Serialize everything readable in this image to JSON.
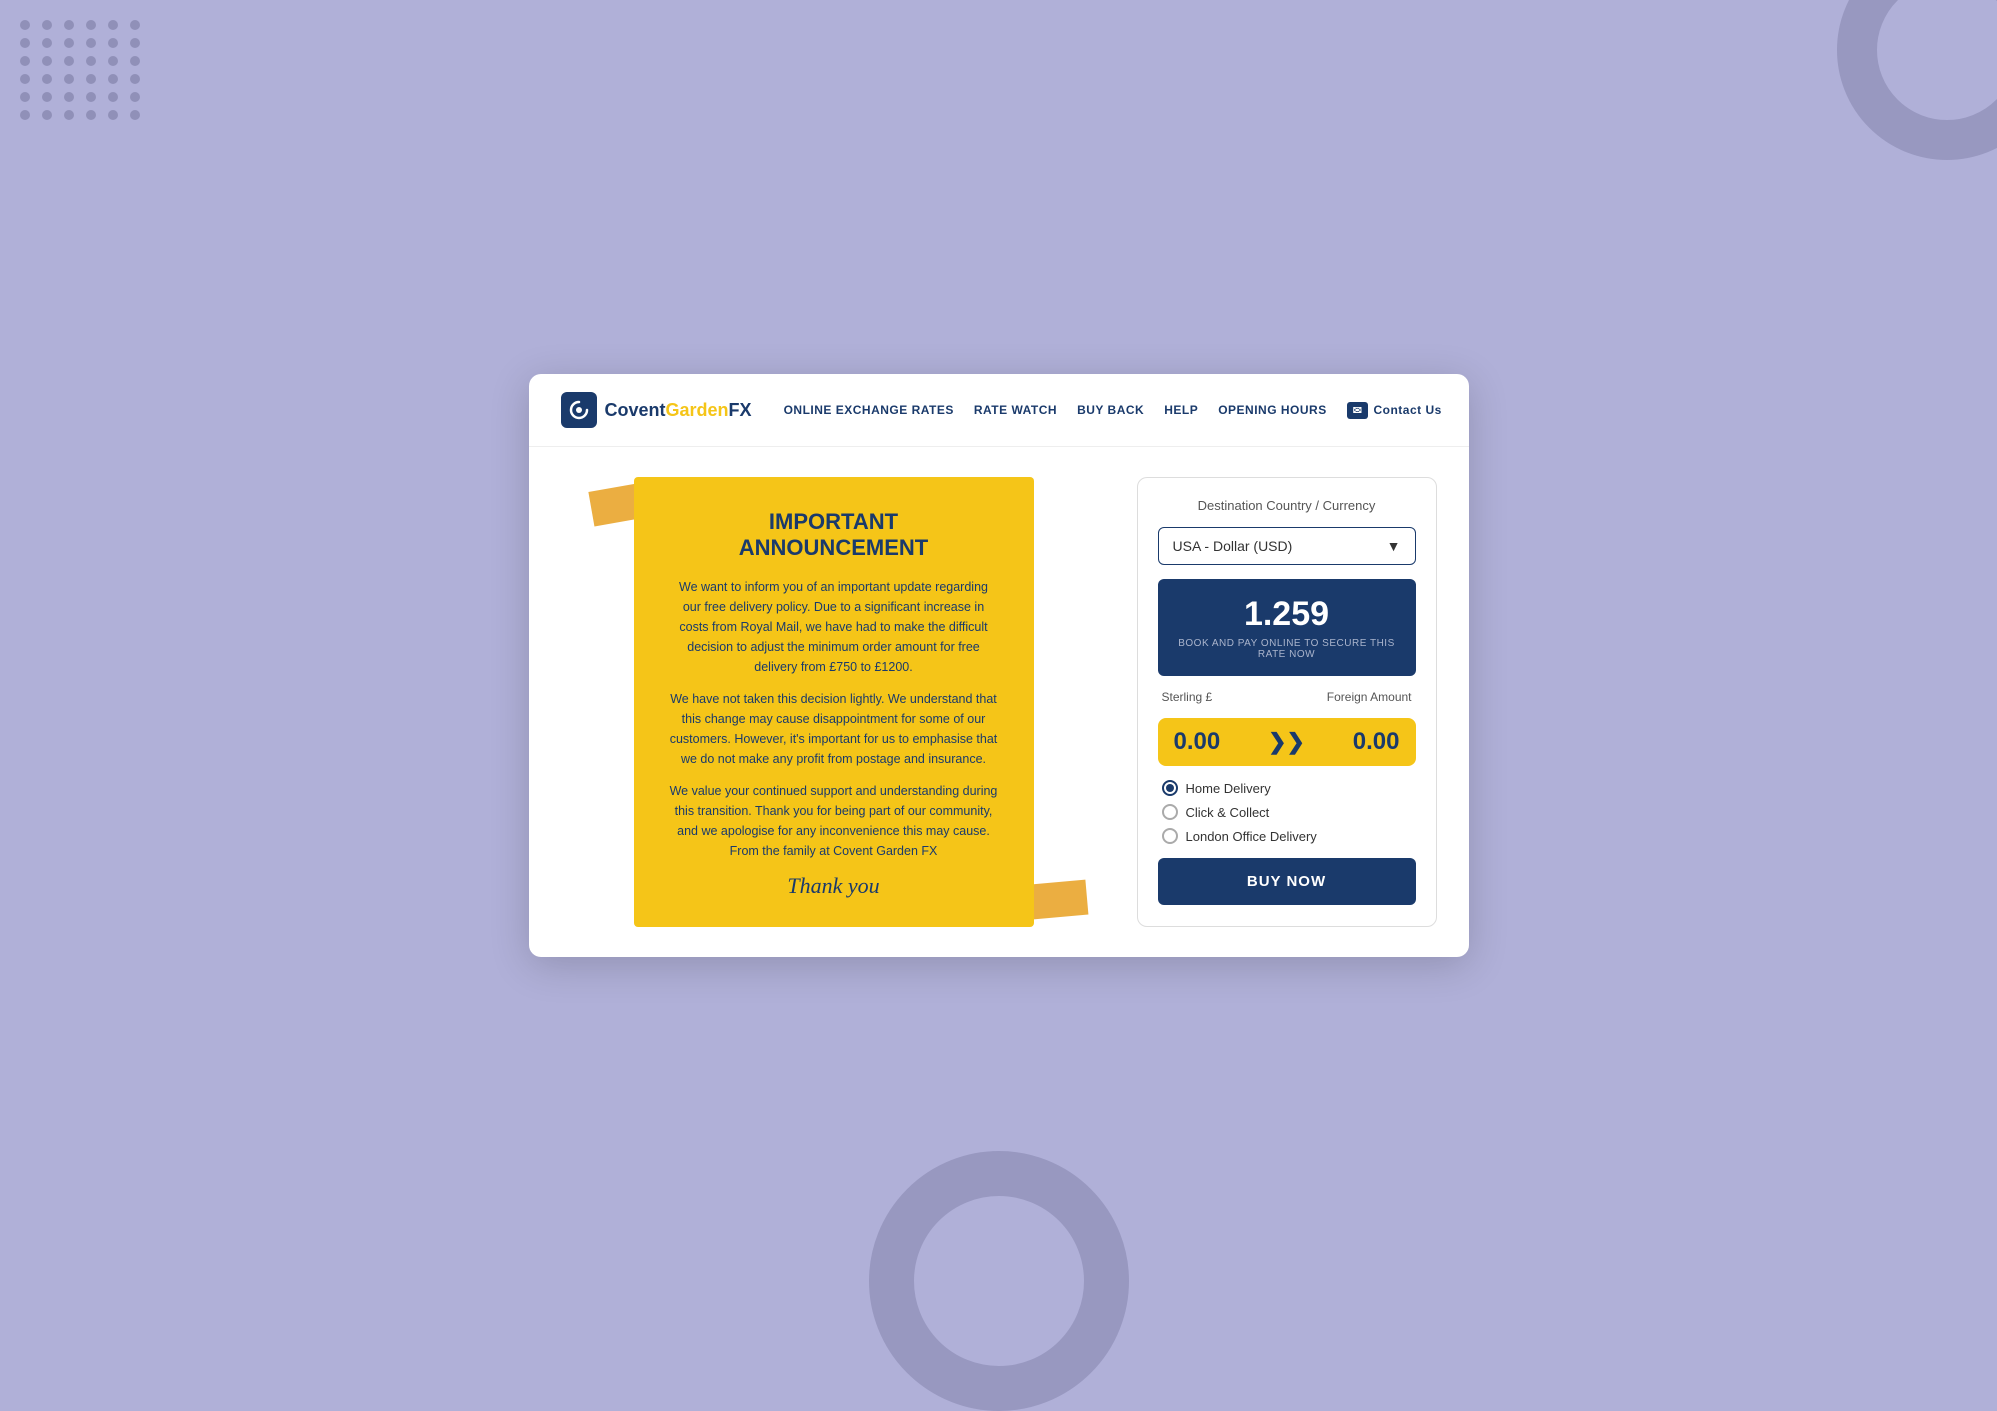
{
  "background": {
    "color": "#b0b0d8"
  },
  "nav": {
    "logo": {
      "covent": "Covent",
      "garden": "Garden",
      "fx": "FX",
      "icon_letter": "G"
    },
    "links": [
      {
        "id": "online-exchange-rates",
        "label": "ONLINE EXCHANGE RATES"
      },
      {
        "id": "rate-watch",
        "label": "RATE WATCH"
      },
      {
        "id": "buy-back",
        "label": "BUY BACK"
      },
      {
        "id": "help",
        "label": "HELP"
      },
      {
        "id": "opening-hours",
        "label": "OPENING HOURS"
      },
      {
        "id": "contact-us",
        "label": "Contact Us",
        "is_contact": true
      }
    ]
  },
  "announcement": {
    "title": "IMPORTANT\nANNOUNCEMENT",
    "paragraphs": [
      "We want to inform you of an important update regarding our free delivery policy. Due to a significant increase in costs from Royal Mail, we have had to make the difficult decision to adjust the minimum order amount for free delivery from £750 to £1200.",
      "We have not taken this decision lightly. We understand that this change may cause disappointment for some of our customers. However, it's important for us to emphasise that we do not make any profit from postage and insurance.",
      "We value your continued support and understanding during this transition. Thank you for being part of our community, and we apologise for any inconvenience this may cause. From the family at Covent Garden FX"
    ],
    "signature": "Thank you"
  },
  "widget": {
    "destination_label": "Destination Country / Currency",
    "selected_currency": "USA - Dollar (USD)",
    "rate": "1.259",
    "rate_cta": "BOOK AND PAY ONLINE TO SECURE THIS RATE NOW",
    "sterling_label": "Sterling £",
    "foreign_label": "Foreign Amount",
    "sterling_value": "0.00",
    "foreign_value": "0.00",
    "delivery_options": [
      {
        "id": "home-delivery",
        "label": "Home Delivery",
        "checked": true
      },
      {
        "id": "click-collect",
        "label": "Click & Collect",
        "checked": false
      },
      {
        "id": "london-office",
        "label": "London Office Delivery",
        "checked": false
      }
    ],
    "buy_button_label": "BUY NOW"
  },
  "dots": {
    "count": 36
  }
}
